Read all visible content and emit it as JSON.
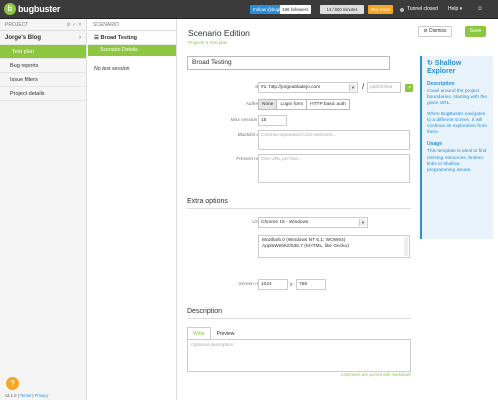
{
  "topbar": {
    "logo_mark": "b",
    "logo_text": "bugbuster",
    "follow_label": "Follow @bugbuster",
    "followers": "186 followers",
    "minutes": "14 / 600 minutes",
    "buy_label": "Buy more",
    "tunnel_label": "Tunnel closed",
    "help_label": "Help ▾",
    "user_icon": "☺"
  },
  "project_sidebar": {
    "header": "PROJECT",
    "tools": "⚙ ✓ ✕",
    "project_name": "Jorge's Blog",
    "chevron": "›",
    "items": [
      {
        "label": "Test plan",
        "active": true
      },
      {
        "label": "Bug reports",
        "active": false
      },
      {
        "label": "Issue filters",
        "active": false
      },
      {
        "label": "Project details",
        "active": false
      }
    ],
    "help_glyph": "?",
    "version": "v2.1.0",
    "terms": "Terms",
    "privacy": "Privacy"
  },
  "scenario_sidebar": {
    "header": "SCENARIO",
    "scenario_name": "Broad Testing",
    "item": "Scenario Details",
    "empty": "No test session"
  },
  "main": {
    "title": "Scenario Edition",
    "crumb_projects": "Projects",
    "crumb_sep": ">",
    "crumb_testplan": "Test plan",
    "dismiss": "Dismiss",
    "save": "Save",
    "name_value": "Broad Testing",
    "start_url_label": "Start URL",
    "start_url_value": "#1: http://jorgeabladejo.com",
    "path_placeholder": "path/to/sta",
    "slash": "/",
    "go_icon": "↗",
    "auth_label": "Authentication",
    "auth_options": [
      "None",
      "Login form",
      "HTTP basic auth"
    ],
    "max_duration_label": "Max session duration",
    "max_duration_value": "15",
    "blacklist_label": "Blacklist elements",
    "blacklist_placeholder": "Comma-separated CSS selectors...",
    "prevent_label": "Prevent navigation",
    "prevent_placeholder": "One URL per line...",
    "extra_title": "Extra options",
    "ua_label": "User Agent",
    "ua_value": "Chrome 16 - Windows",
    "ua_line1": "Mozilla/5.0 (Windows NT 6.1; WOW64)",
    "ua_line2": "AppleWebKit/535.7 (KHTML, like Gecko)",
    "res_label": "Screen resolution",
    "res_w": "1024",
    "res_x": "x",
    "res_h": "768",
    "desc_title": "Description",
    "tab_write": "Write",
    "tab_preview": "Preview",
    "desc_placeholder": "Optional description",
    "markdown_note": "Comments are parsed with markdown"
  },
  "help_panel": {
    "title": "Shallow Explorer",
    "h1": "Description",
    "p1": "Crawl around the project boundaries, starting with the given URL.",
    "p2": "When BugBuster navigates to a different screen, it will continue its exploration from there.",
    "h2": "Usage",
    "p3": "This template is ideal to find missing resources, broken links or shallow programming issues."
  },
  "colors": {
    "accent_green": "#8dc63f",
    "accent_blue": "#2c8fd6",
    "topbar": "#3b3b3b",
    "orange": "#f5a623"
  }
}
